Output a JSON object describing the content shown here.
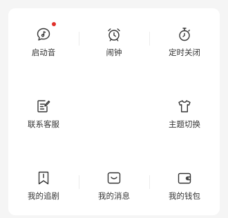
{
  "colors": {
    "page_background": "#f5f5f5",
    "card_background": "#ffffff",
    "icon_stroke": "#333333",
    "label_text": "#333333",
    "badge": "#e0302a",
    "divider": "#ececec"
  },
  "grid": {
    "items": [
      {
        "id": "ringtone",
        "label": "启动音",
        "icon": "music-note-bubble-icon",
        "badge": true
      },
      {
        "id": "alarm",
        "label": "闹钟",
        "icon": "alarm-clock-icon",
        "badge": false
      },
      {
        "id": "timer",
        "label": "定时关闭",
        "icon": "stopwatch-icon",
        "badge": false
      },
      {
        "id": "support",
        "label": "联系客服",
        "icon": "edit-note-icon",
        "badge": false
      },
      {
        "id": "theme",
        "label": "主题切换",
        "icon": "tshirt-icon",
        "badge": false
      },
      {
        "id": "my_shows",
        "label": "我的追剧",
        "icon": "bookmark-icon",
        "badge": false
      },
      {
        "id": "messages",
        "label": "我的消息",
        "icon": "message-box-icon",
        "badge": false
      },
      {
        "id": "wallet",
        "label": "我的钱包",
        "icon": "wallet-icon",
        "badge": false
      }
    ]
  }
}
